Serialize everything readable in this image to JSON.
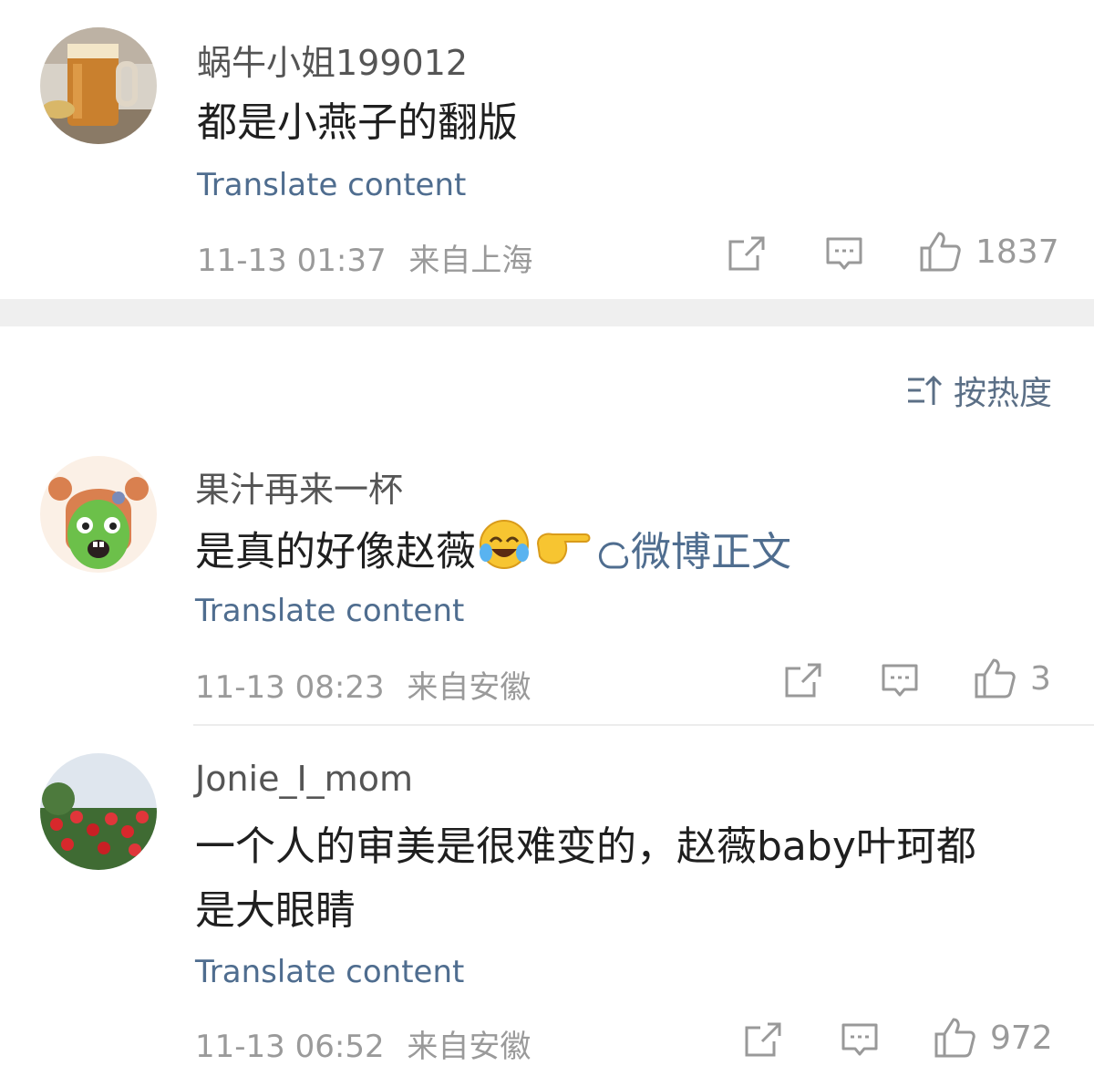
{
  "comments": [
    {
      "username": "蜗牛小姐199012",
      "text": "都是小燕子的翻版",
      "translate_label": "Translate content",
      "timestamp": "11-13 01:37",
      "location": "来自上海",
      "likes": "1837",
      "avatar_icon": "beer-mug-avatar"
    },
    {
      "username": "果汁再来一杯",
      "text": "是真的好像赵薇",
      "link_text": "微博正文",
      "translate_label": "Translate content",
      "timestamp": "11-13 08:23",
      "location": "来自安徽",
      "likes": "3",
      "avatar_icon": "cartoon-girl-avatar"
    },
    {
      "username": "Jonie_I_mom",
      "text_line1": "一个人的审美是很难变的，赵薇baby叶珂都",
      "text_line2": "是大眼睛",
      "translate_label": "Translate content",
      "timestamp": "11-13 06:52",
      "location": "来自安徽",
      "likes": "972",
      "avatar_icon": "roses-avatar"
    }
  ],
  "sort": {
    "label": "按热度",
    "icon": "sort-icon"
  },
  "colors": {
    "translate_link": "#4f6d8f",
    "meta_text": "#9a9a9a",
    "separator": "#efefef"
  }
}
